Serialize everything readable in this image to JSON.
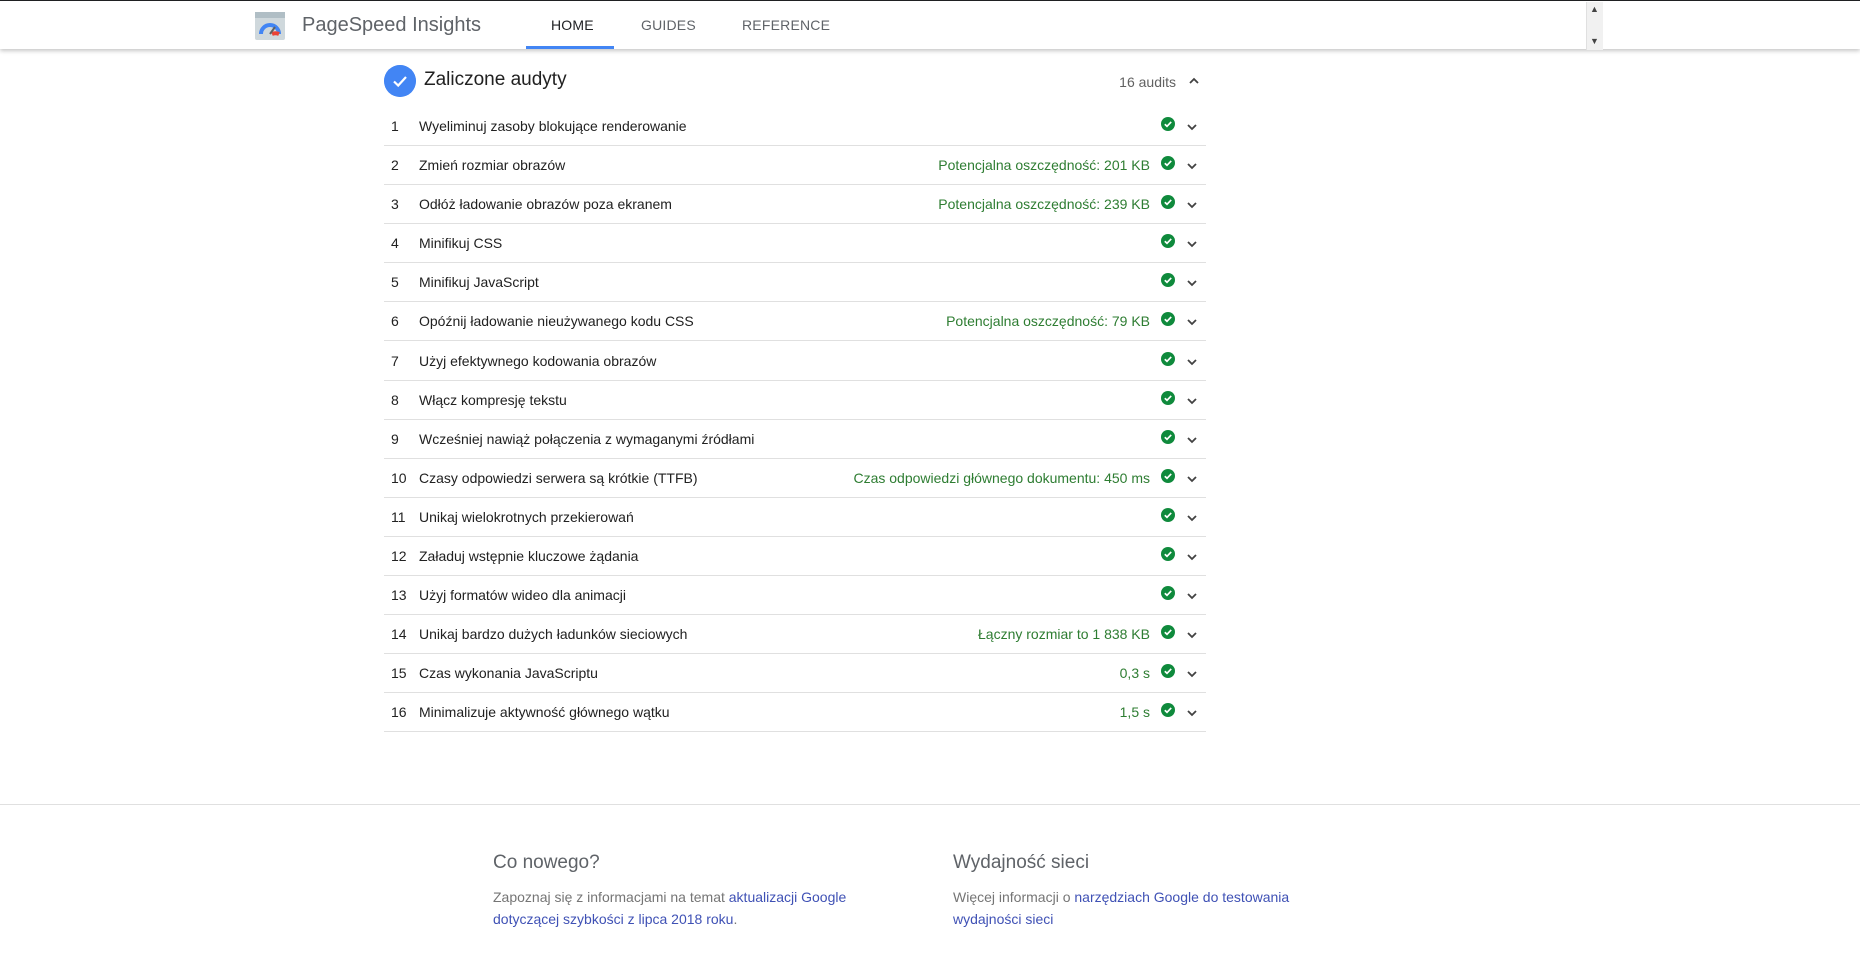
{
  "header": {
    "brand": "PageSpeed Insights",
    "tabs": [
      {
        "label": "HOME",
        "active": true
      },
      {
        "label": "GUIDES",
        "active": false
      },
      {
        "label": "REFERENCE",
        "active": false
      }
    ]
  },
  "section": {
    "title": "Zaliczone audyty",
    "count": "16 audits"
  },
  "audits": [
    {
      "num": "1",
      "title": "Wyeliminuj zasoby blokujące renderowanie",
      "meta": ""
    },
    {
      "num": "2",
      "title": "Zmień rozmiar obrazów",
      "meta": "Potencjalna oszczędność: 201 KB"
    },
    {
      "num": "3",
      "title": "Odłóż ładowanie obrazów poza ekranem",
      "meta": "Potencjalna oszczędność: 239 KB"
    },
    {
      "num": "4",
      "title": "Minifikuj CSS",
      "meta": ""
    },
    {
      "num": "5",
      "title": "Minifikuj JavaScript",
      "meta": ""
    },
    {
      "num": "6",
      "title": "Opóźnij ładowanie nieużywanego kodu CSS",
      "meta": "Potencjalna oszczędność: 79 KB"
    },
    {
      "num": "7",
      "title": "Użyj efektywnego kodowania obrazów",
      "meta": ""
    },
    {
      "num": "8",
      "title": "Włącz kompresję tekstu",
      "meta": ""
    },
    {
      "num": "9",
      "title": "Wcześniej nawiąż połączenia z wymaganymi źródłami",
      "meta": ""
    },
    {
      "num": "10",
      "title": "Czasy odpowiedzi serwera są krótkie (TTFB)",
      "meta": "Czas odpowiedzi głównego dokumentu: 450 ms"
    },
    {
      "num": "11",
      "title": "Unikaj wielokrotnych przekierowań",
      "meta": ""
    },
    {
      "num": "12",
      "title": "Załaduj wstępnie kluczowe żądania",
      "meta": ""
    },
    {
      "num": "13",
      "title": "Użyj formatów wideo dla animacji",
      "meta": ""
    },
    {
      "num": "14",
      "title": "Unikaj bardzo dużych ładunków sieciowych",
      "meta": "Łączny rozmiar to 1 838 KB"
    },
    {
      "num": "15",
      "title": "Czas wykonania JavaScriptu",
      "meta": "0,3 s"
    },
    {
      "num": "16",
      "title": "Minimalizuje aktywność głównego wątku",
      "meta": "1,5 s"
    }
  ],
  "footer": {
    "col1": {
      "title": "Co nowego?",
      "text": "Zapoznaj się z informacjami na temat ",
      "link": "aktualizacji Google dotyczącej szybkości z lipca 2018 roku",
      "after": "."
    },
    "col2": {
      "title": "Wydajność sieci",
      "text": "Więcej informacji o ",
      "link": "narzędziach Google do testowania wydajności sieci",
      "after": ""
    }
  },
  "colors": {
    "accent": "#4285f4",
    "pass": "#0f8a3c",
    "meta": "#2e7d32",
    "link": "#3f51b5"
  },
  "icons": {
    "logo": "pagespeed-logo",
    "section_check": "check-icon",
    "pass": "check-circle-icon",
    "expand": "chevron-down-icon",
    "collapse": "chevron-up-icon"
  }
}
